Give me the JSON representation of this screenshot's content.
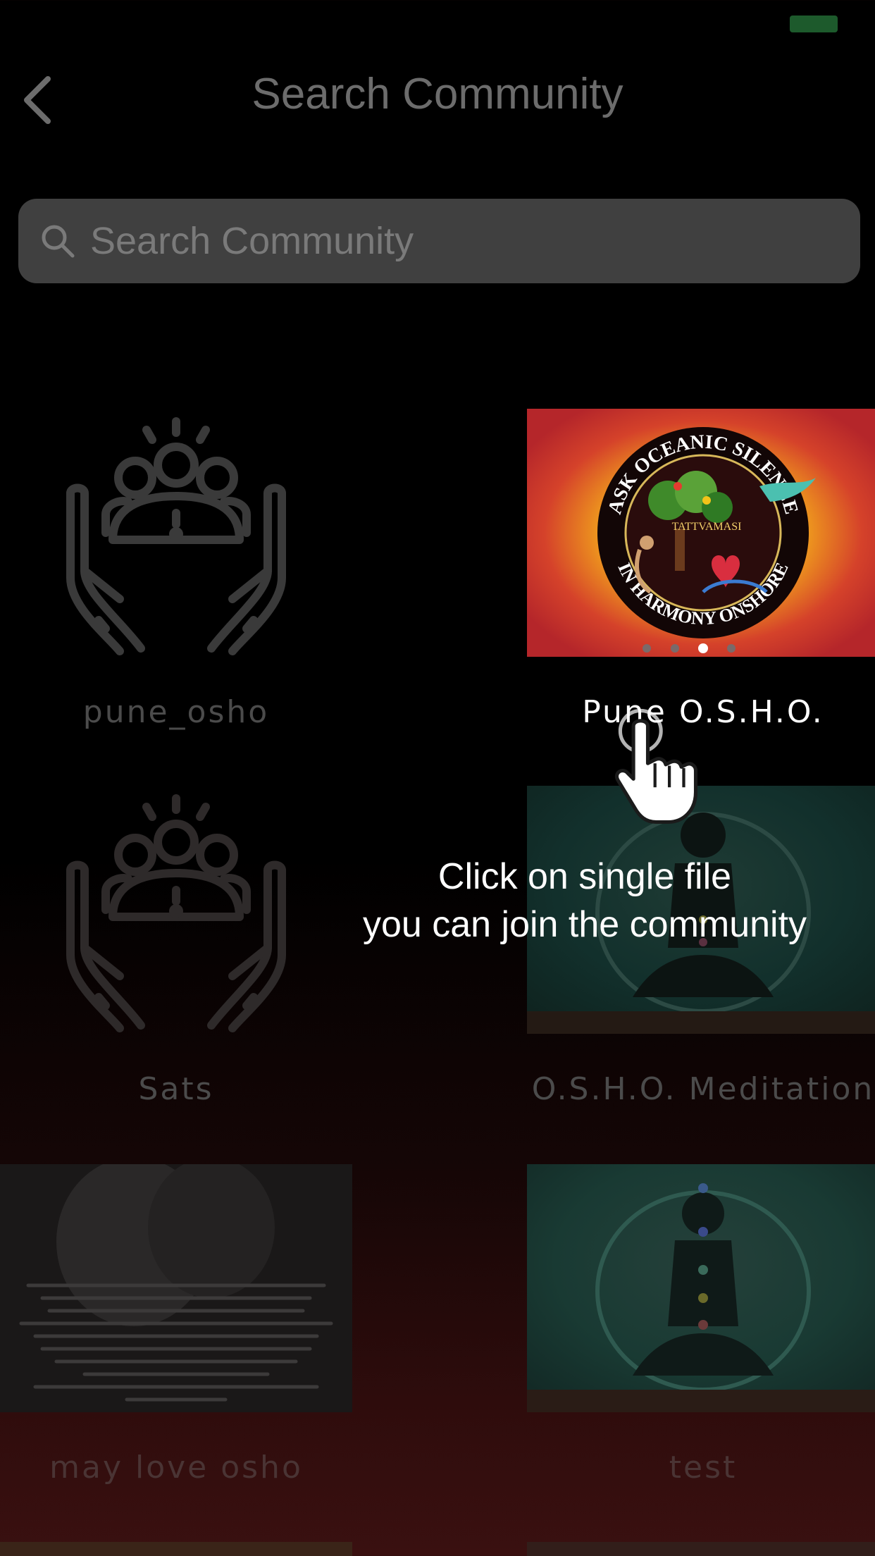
{
  "header": {
    "title": "Search Community"
  },
  "search": {
    "placeholder": "Search Community"
  },
  "communities": [
    {
      "label": "pune_osho"
    },
    {
      "label": "Pune O.S.H.O."
    },
    {
      "label": "Sats"
    },
    {
      "label": "O.S.H.O. Meditation"
    },
    {
      "label": "may love osho"
    },
    {
      "label": "test"
    }
  ],
  "logo": {
    "top_text": "ASK OCEANIC SILENCE",
    "bottom_text": "IN HARMONY ONSHORE",
    "center_text": "TATTVAMASI"
  },
  "tutorial": {
    "line1": "Click on single file",
    "line2": "you can join the community"
  },
  "colors": {
    "accent_status": "#1d5a2c",
    "label": "#4b4b4b",
    "highlight_label": "#ffffff"
  }
}
